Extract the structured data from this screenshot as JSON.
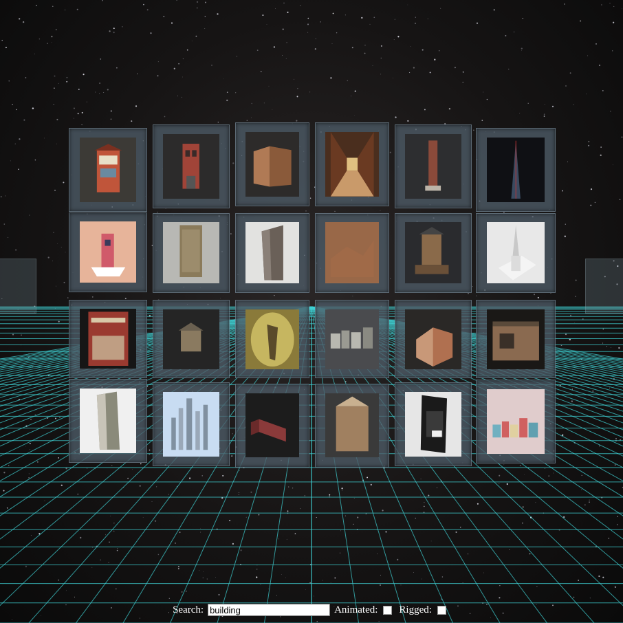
{
  "controls": {
    "search_label": "Search:",
    "search_value": "building",
    "animated_label": "Animated:",
    "animated_checked": false,
    "rigged_label": "Rigged:",
    "rigged_checked": false
  },
  "colors": {
    "grid_line": "#3fd3d6",
    "tile_frame": "#4e5c68",
    "background": "#141212"
  },
  "gallery": {
    "rows": 4,
    "columns": 6,
    "models": [
      {
        "id": "model-1",
        "subject": "colorful townhouse",
        "thumb_bg": "#3c3a36",
        "accent": "#c0553a"
      },
      {
        "id": "model-2",
        "subject": "brick building",
        "thumb_bg": "#2c2b2b",
        "accent": "#a04438"
      },
      {
        "id": "model-3",
        "subject": "curved brick wall",
        "thumb_bg": "#2d2b2a",
        "accent": "#b07a55"
      },
      {
        "id": "model-4",
        "subject": "hallway interior",
        "thumb_bg": "#4a2e1e",
        "accent": "#c99a6a"
      },
      {
        "id": "model-5",
        "subject": "tall narrow tower",
        "thumb_bg": "#2d2e30",
        "accent": "#8a4a3a"
      },
      {
        "id": "model-6",
        "subject": "dark tower",
        "thumb_bg": "#0f1014",
        "accent": "#3a4a60"
      },
      {
        "id": "model-7",
        "subject": "pink low-poly house",
        "thumb_bg": "#e7b49a",
        "accent": "#d05a6a"
      },
      {
        "id": "model-8",
        "subject": "stone skyscraper",
        "thumb_bg": "#b8b8b4",
        "accent": "#8a7a5a"
      },
      {
        "id": "model-9",
        "subject": "flatiron building",
        "thumb_bg": "#e2e2e0",
        "accent": "#6a6058"
      },
      {
        "id": "model-10",
        "subject": "ruined stone structure",
        "thumb_bg": "#b88660",
        "accent": "#7a4a30"
      },
      {
        "id": "model-11",
        "subject": "shop building",
        "thumb_bg": "#2a2b2e",
        "accent": "#8a6a4a"
      },
      {
        "id": "model-12",
        "subject": "white monument",
        "thumb_bg": "#e8e8e8",
        "accent": "#c8c8c8"
      },
      {
        "id": "model-13",
        "subject": "ornate facade",
        "thumb_bg": "#161616",
        "accent": "#9a3a30"
      },
      {
        "id": "model-14",
        "subject": "small ruined house",
        "thumb_bg": "#252525",
        "accent": "#8a7a60"
      },
      {
        "id": "model-15",
        "subject": "blurry tower",
        "thumb_bg": "#8a7a3a",
        "accent": "#e0d070"
      },
      {
        "id": "model-16",
        "subject": "row of buildings",
        "thumb_bg": "#4a4b4e",
        "accent": "#b8b8b0"
      },
      {
        "id": "model-17",
        "subject": "apartment block",
        "thumb_bg": "#2a2826",
        "accent": "#b07050"
      },
      {
        "id": "model-18",
        "subject": "long low building",
        "thumb_bg": "#1a1816",
        "accent": "#8a6a50"
      },
      {
        "id": "model-19",
        "subject": "tall apartment tower",
        "thumb_bg": "#f0f0f0",
        "accent": "#8a8a7a"
      },
      {
        "id": "model-20",
        "subject": "city skyline",
        "thumb_bg": "#c8dcf2",
        "accent": "#8090a0"
      },
      {
        "id": "model-21",
        "subject": "wall segments",
        "thumb_bg": "#1c1c1c",
        "accent": "#8a3a3a"
      },
      {
        "id": "model-22",
        "subject": "wooden crate building",
        "thumb_bg": "#3a3a3a",
        "accent": "#a08060"
      },
      {
        "id": "model-23",
        "subject": "sci-fi tower",
        "thumb_bg": "#e6e6e6",
        "accent": "#1a1a1a"
      },
      {
        "id": "model-24",
        "subject": "colorful shops",
        "thumb_bg": "#e0cccc",
        "accent": "#d06060"
      }
    ]
  }
}
